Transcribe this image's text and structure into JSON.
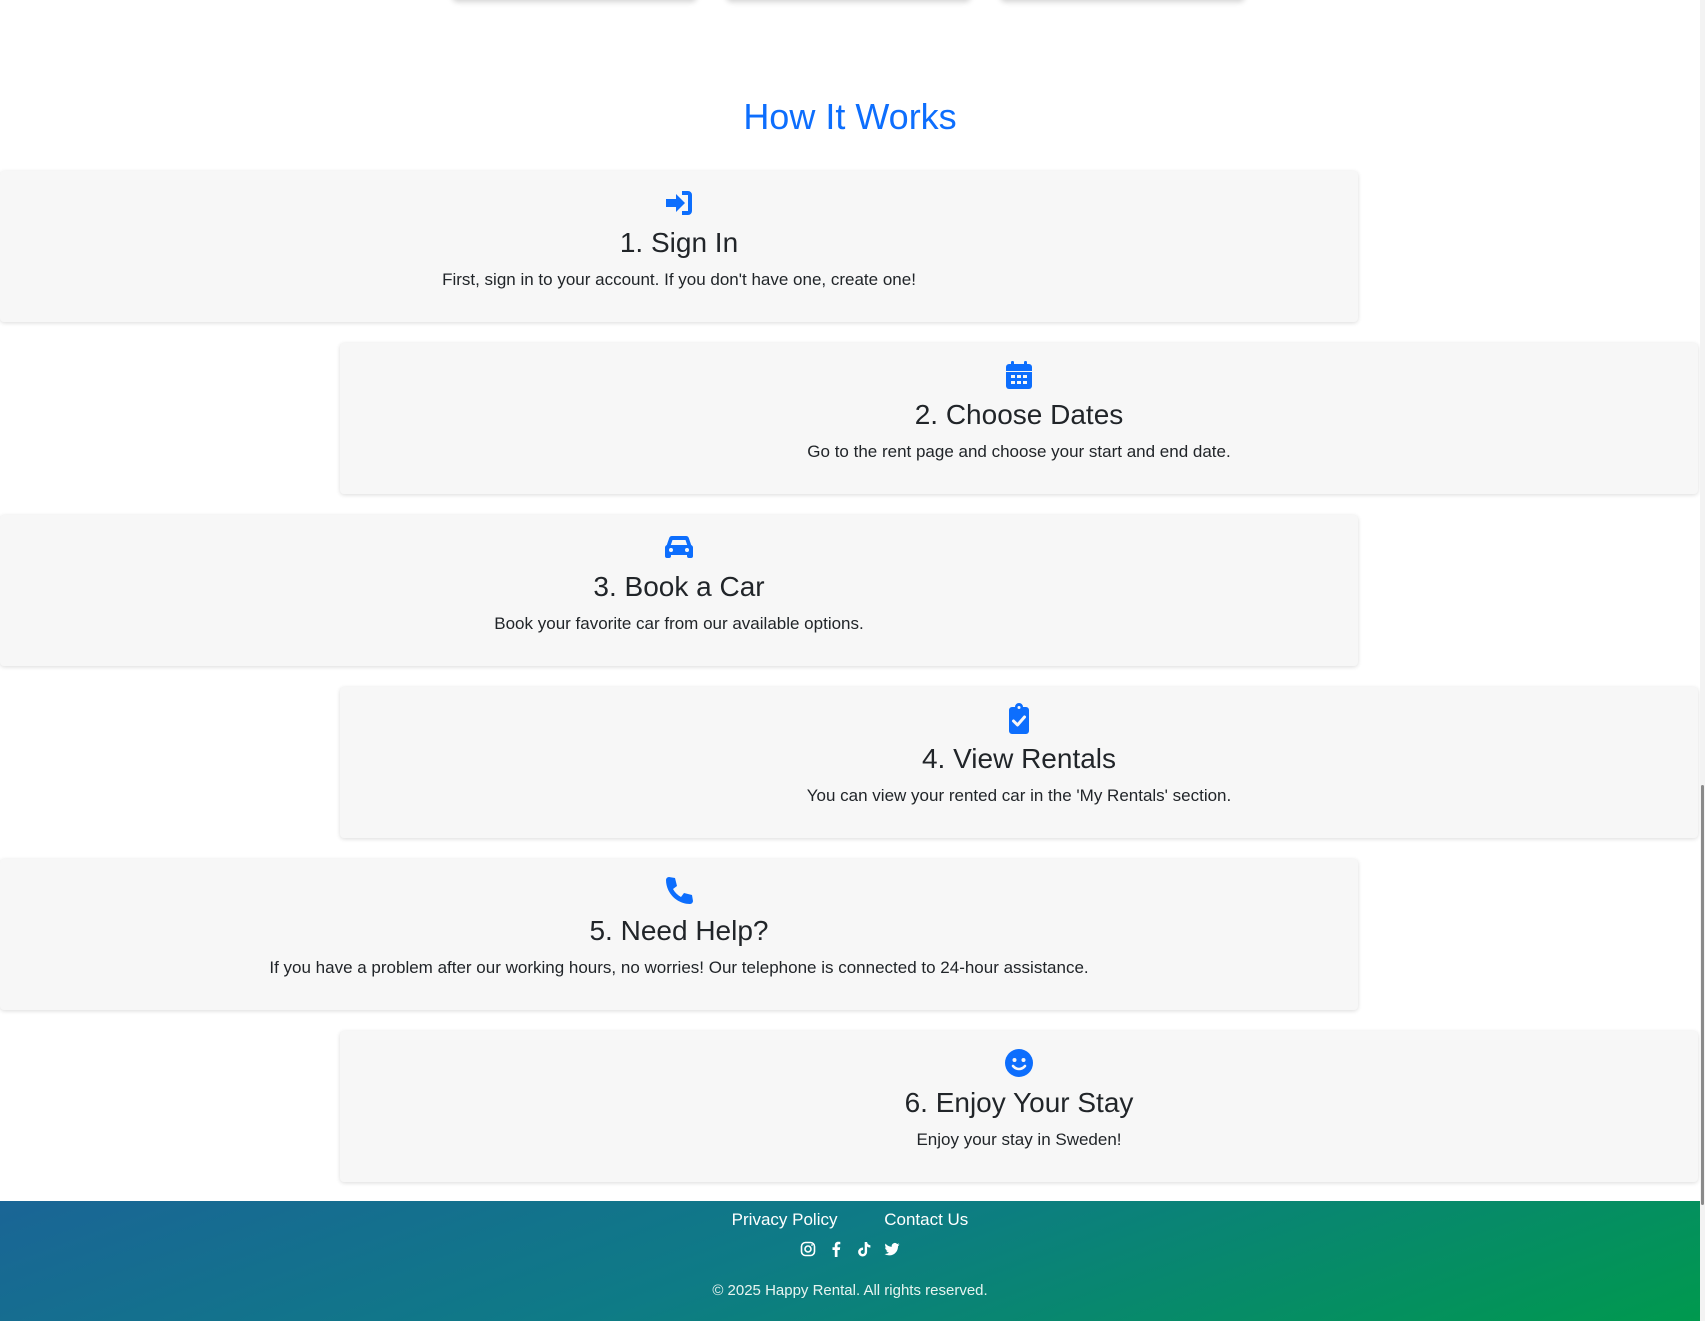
{
  "section": {
    "title": "How It Works"
  },
  "steps": [
    {
      "icon": "sign-in-icon",
      "title": "1. Sign In",
      "description": "First, sign in to your account. If you don't have one, create one!"
    },
    {
      "icon": "calendar-icon",
      "title": "2. Choose Dates",
      "description": "Go to the rent page and choose your start and end date."
    },
    {
      "icon": "car-icon",
      "title": "3. Book a Car",
      "description": "Book your favorite car from our available options."
    },
    {
      "icon": "clipboard-check-icon",
      "title": "4. View Rentals",
      "description": "You can view your rented car in the 'My Rentals' section."
    },
    {
      "icon": "phone-icon",
      "title": "5. Need Help?",
      "description": "If you have a problem after our working hours, no worries! Our telephone is connected to 24-hour assistance."
    },
    {
      "icon": "smile-icon",
      "title": "6. Enjoy Your Stay",
      "description": "Enjoy your stay in Sweden!"
    }
  ],
  "footer": {
    "links": [
      "Privacy Policy",
      "Contact Us"
    ],
    "social": [
      "instagram-icon",
      "facebook-icon",
      "tiktok-icon",
      "twitter-icon"
    ],
    "copyright": "© 2025 Happy Rental. All rights reserved."
  },
  "colors": {
    "accent": "#0d6efd",
    "card_bg": "#f7f7f7",
    "footer_start": "#1a6596",
    "footer_end": "#00994e"
  }
}
